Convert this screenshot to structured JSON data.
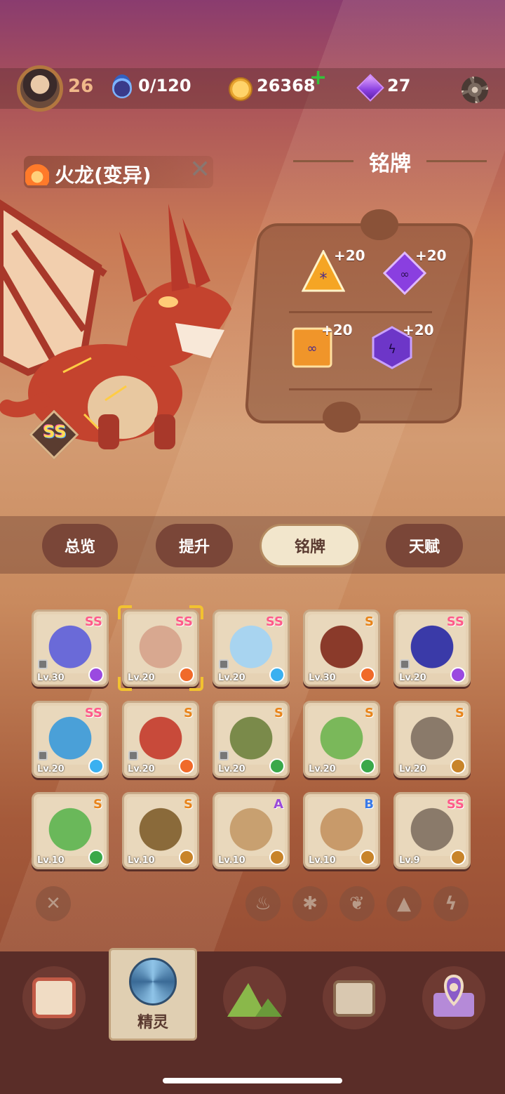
{
  "header": {
    "player_level": "26",
    "stamina": "0/120",
    "coins": "26368",
    "gems": "27"
  },
  "pet": {
    "name": "火龙(变异)",
    "grade": "SS",
    "element_icon": "fire-icon"
  },
  "badge_panel": {
    "title": "铭牌",
    "slots": [
      {
        "icon": "triangle-rune-icon",
        "bonus": "+20",
        "color": "#f5a524"
      },
      {
        "icon": "diamond-rune-icon",
        "bonus": "+20",
        "color": "#8a3fe0"
      },
      {
        "icon": "square-rune-icon",
        "bonus": "+20",
        "color": "#f0952a"
      },
      {
        "icon": "hexagon-rune-icon",
        "bonus": "+20",
        "color": "#6d36c8"
      }
    ]
  },
  "tabs": [
    "总览",
    "提升",
    "铭牌",
    "天赋"
  ],
  "active_tab": "铭牌",
  "pets": [
    {
      "grade": "SS",
      "level": "Lv.30",
      "element": "lightning",
      "locked": true
    },
    {
      "grade": "SS",
      "level": "Lv.20",
      "element": "fire",
      "locked": false,
      "selected": true
    },
    {
      "grade": "SS",
      "level": "Lv.20",
      "element": "ice",
      "locked": true
    },
    {
      "grade": "S",
      "level": "Lv.30",
      "element": "fire",
      "locked": false
    },
    {
      "grade": "SS",
      "level": "Lv.20",
      "element": "lightning",
      "locked": true
    },
    {
      "grade": "SS",
      "level": "Lv.20",
      "element": "ice",
      "locked": true
    },
    {
      "grade": "S",
      "level": "Lv.20",
      "element": "fire",
      "locked": true
    },
    {
      "grade": "S",
      "level": "Lv.20",
      "element": "grass",
      "locked": true
    },
    {
      "grade": "S",
      "level": "Lv.20",
      "element": "grass",
      "locked": false
    },
    {
      "grade": "S",
      "level": "Lv.20",
      "element": "earth",
      "locked": false
    },
    {
      "grade": "S",
      "level": "Lv.10",
      "element": "grass",
      "locked": false
    },
    {
      "grade": "S",
      "level": "Lv.10",
      "element": "earth",
      "locked": false
    },
    {
      "grade": "A",
      "level": "Lv.10",
      "element": "earth",
      "locked": false
    },
    {
      "grade": "B",
      "level": "Lv.10",
      "element": "earth",
      "locked": false
    },
    {
      "grade": "SS",
      "level": "Lv.9",
      "element": "earth",
      "locked": false
    }
  ],
  "filters": [
    "clear-filter-icon",
    "fire-filter-icon",
    "ice-filter-icon",
    "grass-filter-icon",
    "earth-filter-icon",
    "lightning-filter-icon"
  ],
  "bottom_nav": {
    "items": [
      "device-icon",
      "spirit-icon",
      "mountain-icon",
      "chest-icon",
      "map-pin-icon"
    ],
    "active_label": "精灵"
  },
  "colors": {
    "grade_SS": "#ff5a8a",
    "grade_S": "#e8841a",
    "grade_A": "#9a4ad8",
    "grade_B": "#3a7ae8",
    "fire": "#f06a2a",
    "ice": "#3ab0f0",
    "lightning": "#9a4ae0",
    "grass": "#3aa84a",
    "earth": "#c8842a"
  }
}
